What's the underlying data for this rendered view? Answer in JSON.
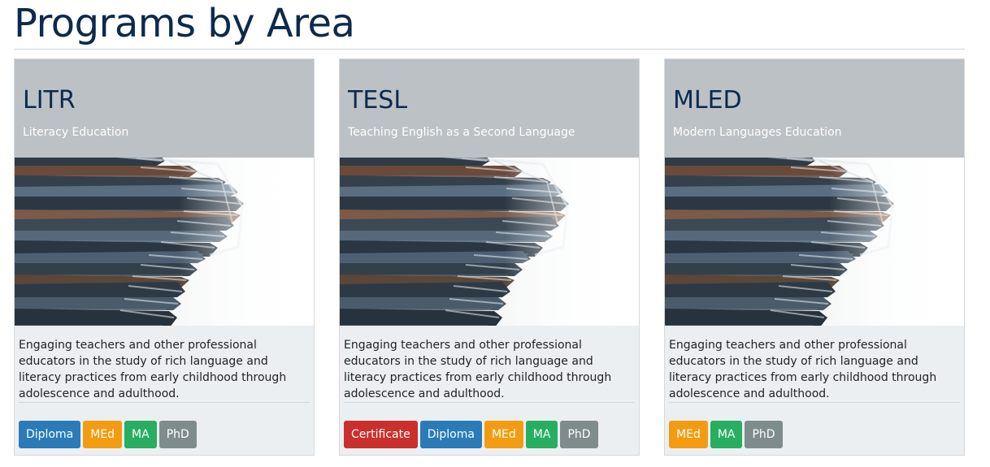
{
  "page": {
    "title": "Programs by Area"
  },
  "colors": {
    "Certificate": "#c9302c",
    "Diploma": "#2a7bb7",
    "MEd": "#f39c12",
    "MA": "#27ae60",
    "PhD": "#7f8c8d"
  },
  "cards": [
    {
      "code": "LITR",
      "name": "Literacy Education",
      "image": "stacked-books-photo",
      "description": "Engaging teachers and other professional educators in the study of rich language and literacy practices from early childhood through adolescence and adulthood.",
      "badges": [
        "Diploma",
        "MEd",
        "MA",
        "PhD"
      ]
    },
    {
      "code": "TESL",
      "name": "Teaching English as a Second Language",
      "image": "stacked-books-photo",
      "description": "Engaging teachers and other professional educators in the study of rich language and literacy practices from early childhood through adolescence and adulthood.",
      "badges": [
        "Certificate",
        "Diploma",
        "MEd",
        "MA",
        "PhD"
      ]
    },
    {
      "code": "MLED",
      "name": "Modern Languages Education",
      "image": "stacked-books-photo",
      "description": "Engaging teachers and other professional educators in the study of rich language and literacy practices from early childhood through adolescence and adulthood.",
      "badges": [
        "MEd",
        "MA",
        "PhD"
      ]
    }
  ]
}
